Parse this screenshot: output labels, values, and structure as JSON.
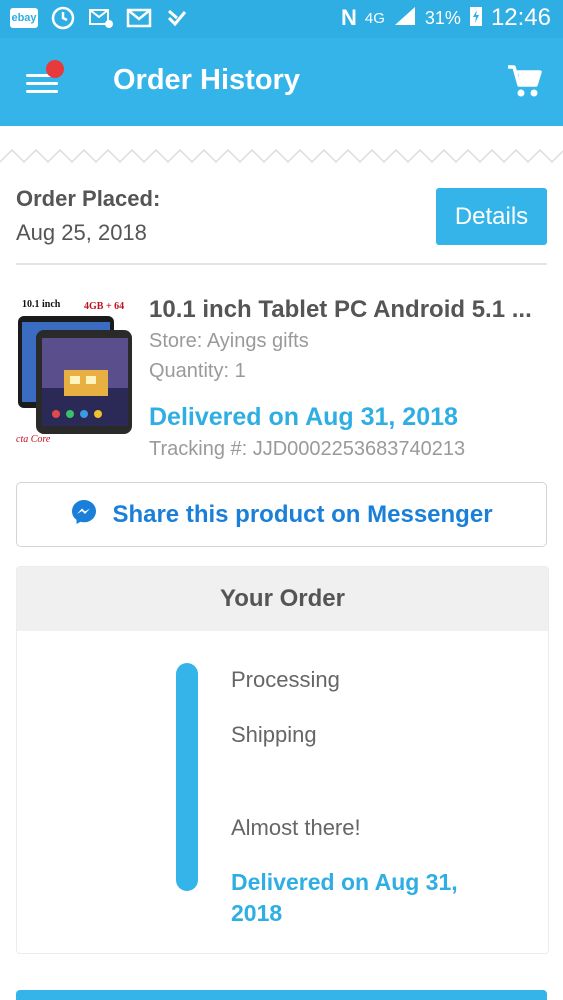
{
  "status_bar": {
    "ebay_label": "ebay",
    "network_label": "4G",
    "battery": "31%",
    "time": "12:46"
  },
  "app_bar": {
    "title": "Order History",
    "colors": {
      "primary": "#34b4e9",
      "notification": "#e83a3a"
    }
  },
  "order": {
    "placed_label": "Order Placed:",
    "placed_date": "Aug 25, 2018",
    "details_button": "Details"
  },
  "product": {
    "image_labels": {
      "size": "10.1 inch",
      "spec": "4GB + 64",
      "core": "cta Core"
    },
    "title": "10.1 inch Tablet PC Android 5.1 ...",
    "store": "Store: Ayings gifts",
    "quantity": "Quantity: 1",
    "delivered": "Delivered on Aug 31, 2018",
    "tracking": "Tracking #: JJD0002253683740213"
  },
  "share": {
    "label": "Share this product on Messenger",
    "icon": "messenger-icon"
  },
  "your_order": {
    "heading": "Your Order",
    "steps": [
      "Processing",
      "Shipping",
      "Almost there!"
    ],
    "final_step": "Delivered on Aug 31, 2018"
  }
}
